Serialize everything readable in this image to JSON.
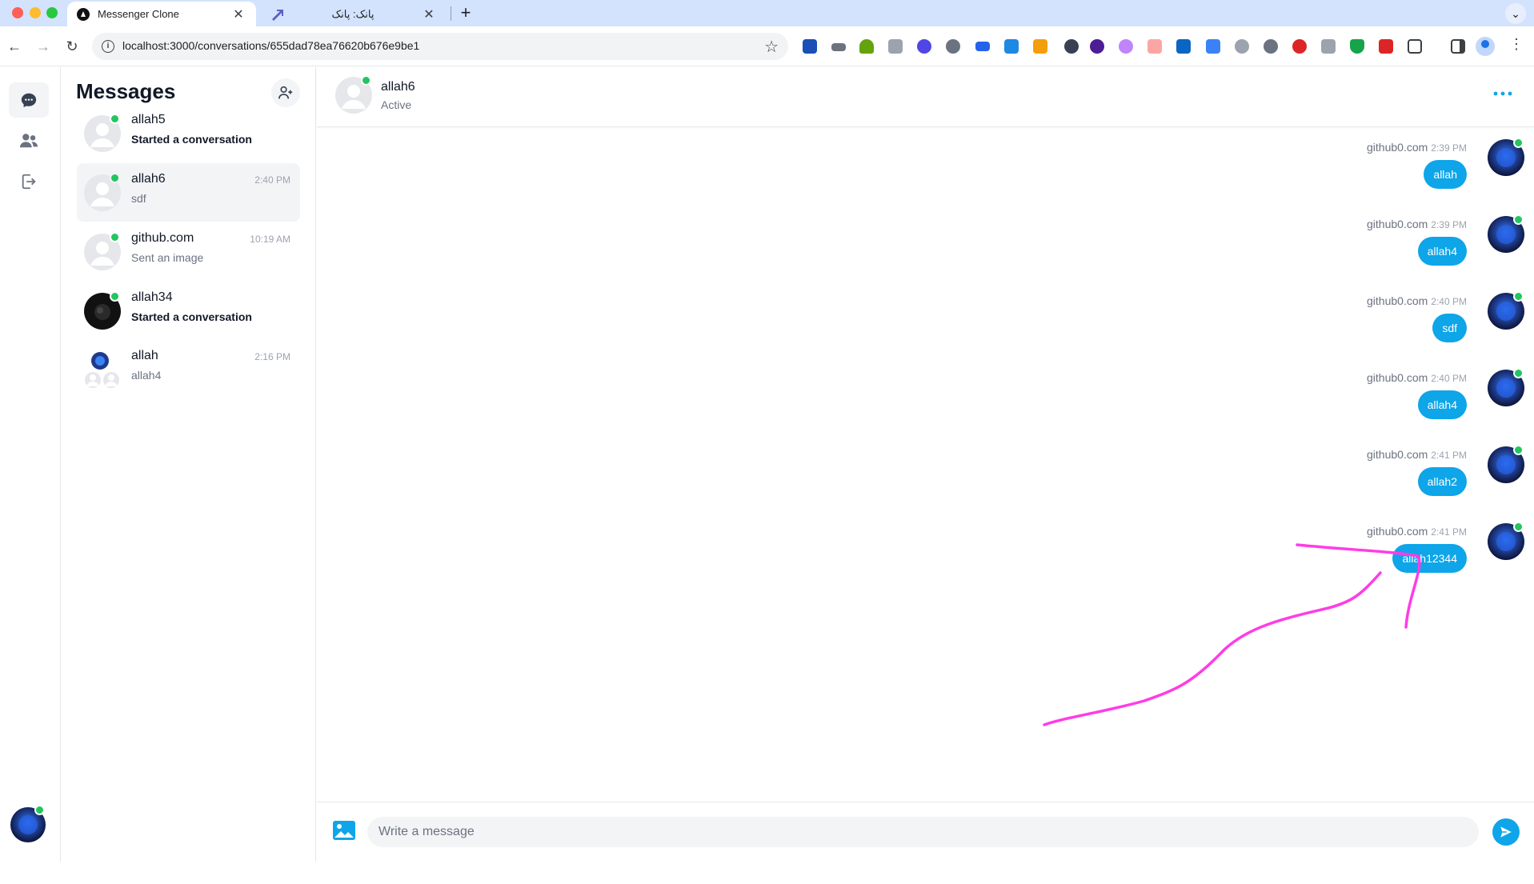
{
  "browser": {
    "tabs": [
      {
        "title": "Messenger Clone",
        "active": true
      },
      {
        "title": "پانک: پانک",
        "active": false
      }
    ],
    "url": "localhost:3000/conversations/655dad78ea76620b676e9be1"
  },
  "sidebar_nav": {
    "items": [
      "chat-icon",
      "users-icon",
      "logout-icon"
    ]
  },
  "conversation_list": {
    "title": "Messages",
    "items": [
      {
        "name": "allah5",
        "time": "",
        "last": "Started a conversation",
        "unread": true,
        "online": true,
        "avatar": "placeholder"
      },
      {
        "name": "allah6",
        "time": "2:40 PM",
        "last": "sdf",
        "unread": false,
        "online": true,
        "avatar": "placeholder",
        "selected": true
      },
      {
        "name": "github.com",
        "time": "10:19 AM",
        "last": "Sent an image",
        "unread": false,
        "online": true,
        "avatar": "placeholder"
      },
      {
        "name": "allah34",
        "time": "",
        "last": "Started a conversation",
        "unread": true,
        "online": true,
        "avatar": "photo-dark"
      },
      {
        "name": "allah",
        "time": "2:16 PM",
        "last": "allah4",
        "unread": false,
        "online": false,
        "avatar": "group"
      }
    ]
  },
  "chat": {
    "header": {
      "name": "allah6",
      "status": "Active"
    },
    "messages": [
      {
        "sender": "github0.com",
        "time": "2:39 PM",
        "body": "allah"
      },
      {
        "sender": "github0.com",
        "time": "2:39 PM",
        "body": "allah4"
      },
      {
        "sender": "github0.com",
        "time": "2:40 PM",
        "body": "sdf"
      },
      {
        "sender": "github0.com",
        "time": "2:40 PM",
        "body": "allah4"
      },
      {
        "sender": "github0.com",
        "time": "2:41 PM",
        "body": "allah2"
      },
      {
        "sender": "github0.com",
        "time": "2:41 PM",
        "body": "allah12344"
      }
    ],
    "composer": {
      "placeholder": "Write a message"
    }
  },
  "colors": {
    "accent": "#0ea5e9",
    "online": "#22c55e",
    "annotation": "#ff3ce6"
  }
}
